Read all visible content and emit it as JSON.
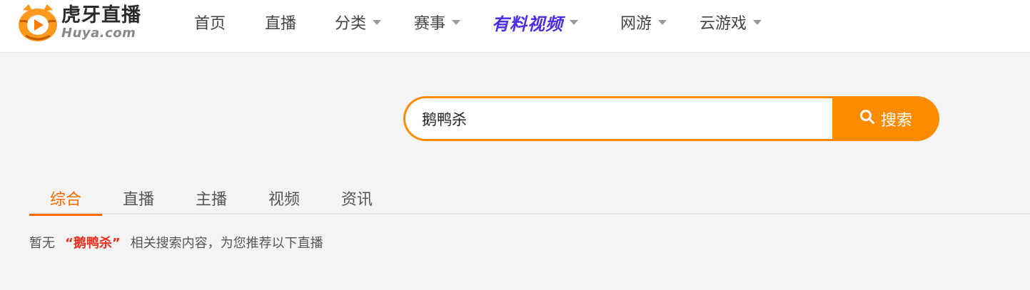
{
  "brand": {
    "name_cn": "虎牙直播",
    "name_en": "Huya.com",
    "colors": {
      "primary": "#ff8c00",
      "accent_tab": "#ff6a00",
      "highlight": "#e8301c",
      "special_nav": "#4b2ee6"
    }
  },
  "nav": {
    "items": [
      {
        "label": "首页",
        "has_dropdown": false
      },
      {
        "label": "直播",
        "has_dropdown": false
      },
      {
        "label": "分类",
        "has_dropdown": true
      },
      {
        "label": "赛事",
        "has_dropdown": true
      },
      {
        "label": "有料视频",
        "has_dropdown": true
      },
      {
        "label": "网游",
        "has_dropdown": true
      },
      {
        "label": "云游戏",
        "has_dropdown": true
      }
    ]
  },
  "search": {
    "value": "鹅鸭杀",
    "button_label": "搜索",
    "button_icon": "search-icon"
  },
  "tabs": {
    "items": [
      {
        "label": "综合",
        "active": true
      },
      {
        "label": "直播",
        "active": false
      },
      {
        "label": "主播",
        "active": false
      },
      {
        "label": "视频",
        "active": false
      },
      {
        "label": "资讯",
        "active": false
      }
    ]
  },
  "notice": {
    "prefix": "暂无",
    "keyword": "“鹅鸭杀”",
    "suffix": "相关搜索内容，为您推荐以下直播"
  }
}
